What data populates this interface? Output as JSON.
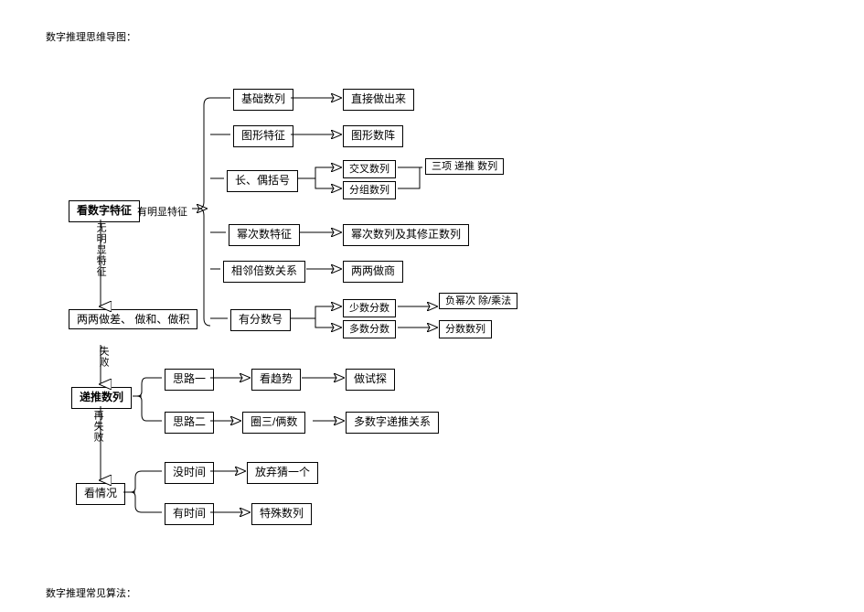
{
  "title_top": "数字推理思维导图：",
  "title_bottom": "数字推理常见算法：",
  "root": "看数字特征",
  "branch_a_label": "有明显特征",
  "branch_b_label": "无明显特征",
  "a1": "基础数列",
  "a1r": "直接做出来",
  "a2": "图形特征",
  "a2r": "图形数阵",
  "a3": "长、偶括号",
  "a3r1": "交叉数列",
  "a3r2": "分组数列",
  "a3side": "三项\n递推\n数列",
  "a4": "幂次数特征",
  "a4r": "幂次数列及其修正数列",
  "a5": "相邻倍数关系",
  "a5r": "两两做商",
  "a6": "有分数号",
  "a6r1": "少数分数",
  "a6r2": "多数分数",
  "a6s1": "负幂次\n除/乘法",
  "a6s2": "分数数列",
  "b1": "两两做差、\n做和、做积",
  "b1_fail": "失败",
  "b2": "递推数列",
  "b2a": "思路一",
  "b2a_r1": "看趋势",
  "b2a_r2": "做试探",
  "b2b": "思路二",
  "b2b_r1": "圈三/俩数",
  "b2b_r2": "多数字递推关系",
  "b2_fail": "再失败",
  "b3": "看情况",
  "b3a": "没时间",
  "b3a_r": "放弃猜一个",
  "b3b": "有时间",
  "b3b_r": "特殊数列"
}
